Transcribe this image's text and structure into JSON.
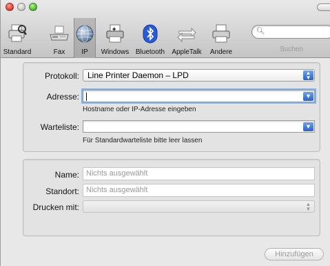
{
  "toolbar": {
    "items": [
      {
        "label": "Standard",
        "icon": "printer-magnifier-icon"
      },
      {
        "label": "Fax",
        "icon": "fax-icon"
      },
      {
        "label": "IP",
        "icon": "globe-icon"
      },
      {
        "label": "Windows",
        "icon": "windows-printer-icon"
      },
      {
        "label": "Bluetooth",
        "icon": "bluetooth-icon"
      },
      {
        "label": "AppleTalk",
        "icon": "appletalk-icon"
      },
      {
        "label": "Andere",
        "icon": "printer-icon"
      }
    ],
    "selected": "IP",
    "search_label": "Suchen"
  },
  "form": {
    "protocol_label": "Protokoll:",
    "protocol_value": "Line Printer Daemon – LPD",
    "address_label": "Adresse:",
    "address_value": "",
    "address_hint": "Hostname oder IP-Adresse eingeben",
    "queue_label": "Warteliste:",
    "queue_value": "",
    "queue_hint": "Für Standardwarteliste bitte leer lassen"
  },
  "details": {
    "name_label": "Name:",
    "name_placeholder": "Nichts ausgewählt",
    "location_label": "Standort:",
    "location_placeholder": "Nichts ausgewählt",
    "print_with_label": "Drucken mit:",
    "print_with_value": ""
  },
  "footer": {
    "add_label": "Hinzufügen"
  },
  "colors": {
    "accent": "#2a62c7",
    "focus_ring": "#7fb1ea"
  }
}
